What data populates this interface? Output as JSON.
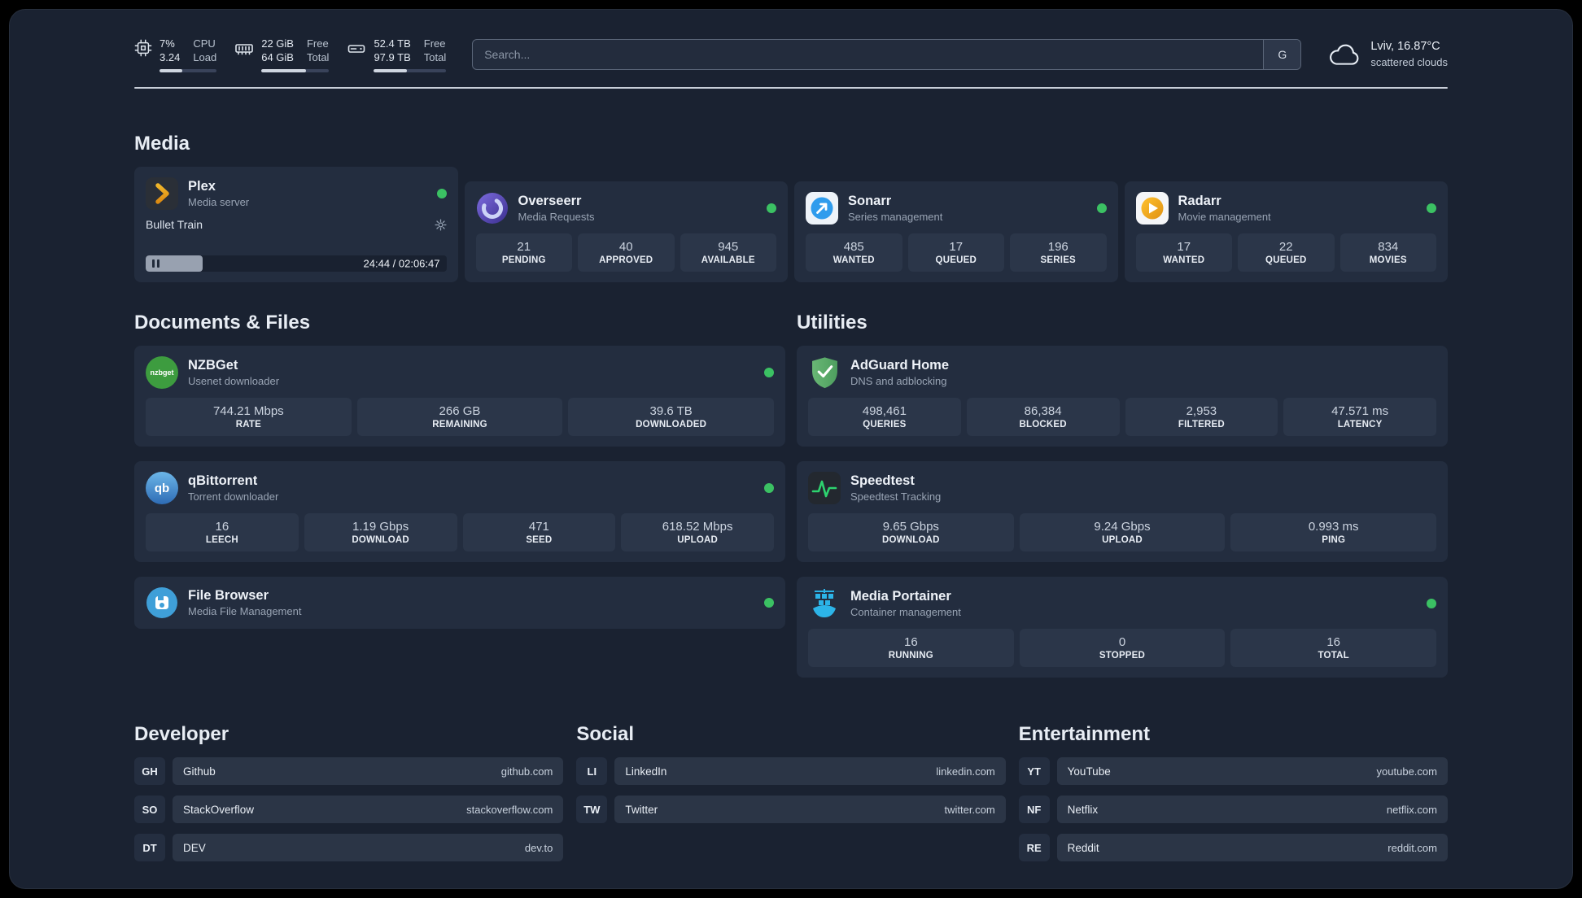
{
  "colors": {
    "status_online": "#3bc163",
    "background": "#1a2231",
    "card": "#232d3f"
  },
  "topbar": {
    "cpu": {
      "percent": "7%",
      "load": "3.24",
      "label1": "CPU",
      "label2": "Load",
      "bar": 40
    },
    "ram": {
      "free": "22 GiB",
      "total": "64 GiB",
      "label1": "Free",
      "label2": "Total",
      "bar": 66
    },
    "disk": {
      "free": "52.4 TB",
      "total": "97.9 TB",
      "label1": "Free",
      "label2": "Total",
      "bar": 46
    },
    "search": {
      "placeholder": "Search...",
      "engine_label": "G"
    },
    "weather": {
      "location": "Lviv, 16.87°C",
      "condition": "scattered clouds"
    }
  },
  "sections": {
    "media": {
      "title": "Media"
    },
    "documents": {
      "title": "Documents & Files"
    },
    "utilities": {
      "title": "Utilities"
    },
    "developer": {
      "title": "Developer"
    },
    "social": {
      "title": "Social"
    },
    "entertainment": {
      "title": "Entertainment"
    }
  },
  "apps": {
    "plex": {
      "name": "Plex",
      "subtitle": "Media server",
      "now_playing": "Bullet Train",
      "time": "24:44 / 02:06:47",
      "progress": 19
    },
    "overseerr": {
      "name": "Overseerr",
      "subtitle": "Media Requests",
      "stats": [
        {
          "v": "21",
          "l": "PENDING"
        },
        {
          "v": "40",
          "l": "APPROVED"
        },
        {
          "v": "945",
          "l": "AVAILABLE"
        }
      ]
    },
    "sonarr": {
      "name": "Sonarr",
      "subtitle": "Series management",
      "stats": [
        {
          "v": "485",
          "l": "WANTED"
        },
        {
          "v": "17",
          "l": "QUEUED"
        },
        {
          "v": "196",
          "l": "SERIES"
        }
      ]
    },
    "radarr": {
      "name": "Radarr",
      "subtitle": "Movie management",
      "stats": [
        {
          "v": "17",
          "l": "WANTED"
        },
        {
          "v": "22",
          "l": "QUEUED"
        },
        {
          "v": "834",
          "l": "MOVIES"
        }
      ]
    },
    "nzbget": {
      "name": "NZBGet",
      "subtitle": "Usenet downloader",
      "icon_text": "nzbget",
      "stats": [
        {
          "v": "744.21 Mbps",
          "l": "RATE"
        },
        {
          "v": "266 GB",
          "l": "REMAINING"
        },
        {
          "v": "39.6 TB",
          "l": "DOWNLOADED"
        }
      ]
    },
    "qbittorrent": {
      "name": "qBittorrent",
      "subtitle": "Torrent downloader",
      "icon_text": "qb",
      "stats": [
        {
          "v": "16",
          "l": "LEECH"
        },
        {
          "v": "1.19 Gbps",
          "l": "DOWNLOAD"
        },
        {
          "v": "471",
          "l": "SEED"
        },
        {
          "v": "618.52 Mbps",
          "l": "UPLOAD"
        }
      ]
    },
    "filebrowser": {
      "name": "File Browser",
      "subtitle": "Media File Management"
    },
    "adguard": {
      "name": "AdGuard Home",
      "subtitle": "DNS and adblocking",
      "stats": [
        {
          "v": "498,461",
          "l": "QUERIES"
        },
        {
          "v": "86,384",
          "l": "BLOCKED"
        },
        {
          "v": "2,953",
          "l": "FILTERED"
        },
        {
          "v": "47.571 ms",
          "l": "LATENCY"
        }
      ]
    },
    "speedtest": {
      "name": "Speedtest",
      "subtitle": "Speedtest Tracking",
      "stats": [
        {
          "v": "9.65 Gbps",
          "l": "DOWNLOAD"
        },
        {
          "v": "9.24 Gbps",
          "l": "UPLOAD"
        },
        {
          "v": "0.993 ms",
          "l": "PING"
        }
      ]
    },
    "portainer": {
      "name": "Media Portainer",
      "subtitle": "Container management",
      "stats": [
        {
          "v": "16",
          "l": "RUNNING"
        },
        {
          "v": "0",
          "l": "STOPPED"
        },
        {
          "v": "16",
          "l": "TOTAL"
        }
      ]
    }
  },
  "bookmarks": {
    "developer": [
      {
        "abbr": "GH",
        "name": "Github",
        "url": "github.com"
      },
      {
        "abbr": "SO",
        "name": "StackOverflow",
        "url": "stackoverflow.com"
      },
      {
        "abbr": "DT",
        "name": "DEV",
        "url": "dev.to"
      }
    ],
    "social": [
      {
        "abbr": "LI",
        "name": "LinkedIn",
        "url": "linkedin.com"
      },
      {
        "abbr": "TW",
        "name": "Twitter",
        "url": "twitter.com"
      }
    ],
    "entertainment": [
      {
        "abbr": "YT",
        "name": "YouTube",
        "url": "youtube.com"
      },
      {
        "abbr": "NF",
        "name": "Netflix",
        "url": "netflix.com"
      },
      {
        "abbr": "RE",
        "name": "Reddit",
        "url": "reddit.com"
      }
    ]
  }
}
